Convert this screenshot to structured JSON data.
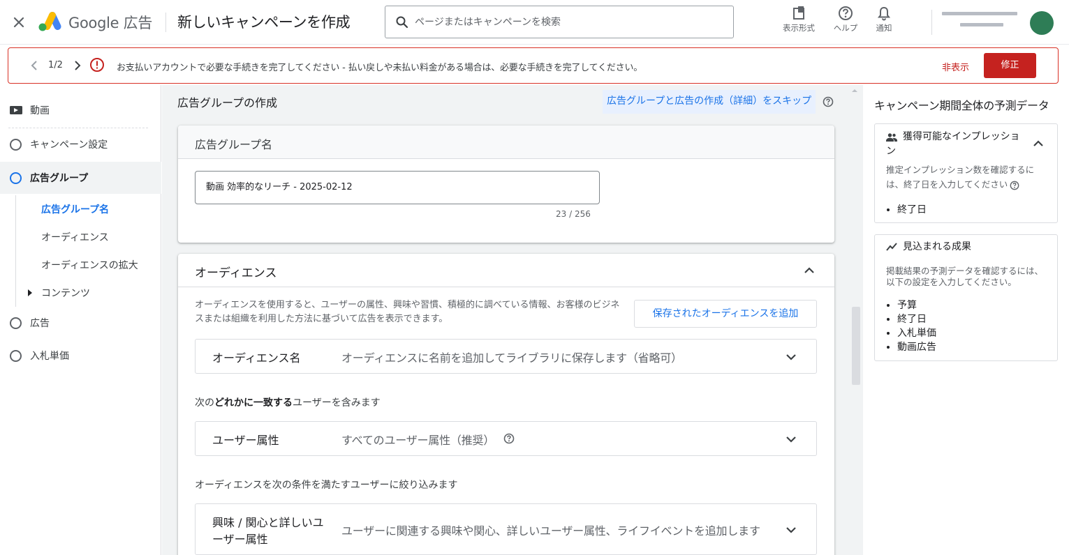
{
  "header": {
    "brand": "Google 広告",
    "title": "新しいキャンペーンを作成",
    "search_placeholder": "ページまたはキャンペーンを検索",
    "tools": [
      {
        "icon": "appearance-icon",
        "label": "表示形式"
      },
      {
        "icon": "help-icon",
        "label": "ヘルプ"
      },
      {
        "icon": "bell-icon",
        "label": "通知"
      }
    ],
    "brand_colors": {
      "blue": "#4285f4",
      "yellow": "#fbbc04",
      "green": "#34a853"
    }
  },
  "alert": {
    "counter": "1/2",
    "message": "お支払いアカウントで必要な手続きを完了してください - 払い戻しや未払い料金がある場合は、必要な手続きを完了してください。",
    "hide_label": "非表示",
    "fix_label": "修正",
    "color": "#c5221f"
  },
  "nav": {
    "video": "動画",
    "campaign_settings": "キャンペーン設定",
    "ad_group": "広告グループ",
    "sub": {
      "ad_group_name": "広告グループ名",
      "audience": "オーディエンス",
      "audience_expansion": "オーディエンスの拡大",
      "content": "コンテンツ"
    },
    "ads": "広告",
    "bidding": "入札単価"
  },
  "main": {
    "section_title": "広告グループの作成",
    "skip_link": "広告グループと広告の作成（詳細）をスキップ",
    "name_card": {
      "title": "広告グループ名",
      "value": "動画 効率的なリーチ - 2025-02-12",
      "count": "23 / 256"
    },
    "audience_card": {
      "title": "オーディエンス",
      "description": "オーディエンスを使用すると、ユーザーの属性、興味や習慣、積極的に調べている情報、お客様のビジネスまたは組織を利用した方法に基づいて広告を表示できます。",
      "add_button": "保存されたオーディエンスを追加",
      "name_row": {
        "key": "オーディエンス名",
        "value": "オーディエンスに名前を追加してライブラリに保存します（省略可）"
      },
      "include_prefix": "次の",
      "include_bold": "どれかに一致する",
      "include_suffix": "ユーザーを含みます",
      "demo_row": {
        "key": "ユーザー属性",
        "value": "すべてのユーザー属性（推奨）"
      },
      "narrow_text": "オーディエンスを次の条件を満たすユーザーに絞り込みます",
      "interest_row": {
        "key_line1": "興味 / 関心と詳しいユ",
        "key_line2": "ーザー属性",
        "value": "ユーザーに関連する興味や関心、詳しいユーザー属性、ライフイベントを追加します"
      }
    }
  },
  "forecast": {
    "title": "キャンペーン期間全体の予測データ",
    "impressions": {
      "title_line1": "獲得可能なインプレッショ",
      "title_line2": "ン",
      "desc_line1": "推定インプレッション数を確認するに",
      "desc_line2": "は、終了日を入力してください",
      "items": [
        "終了日"
      ]
    },
    "results": {
      "title": "見込まれる成果",
      "desc_line1": "掲載結果の予測データを確認するには、",
      "desc_line2": "以下の設定を入力してください。",
      "items": [
        "予算",
        "終了日",
        "入札単価",
        "動画広告"
      ]
    }
  }
}
